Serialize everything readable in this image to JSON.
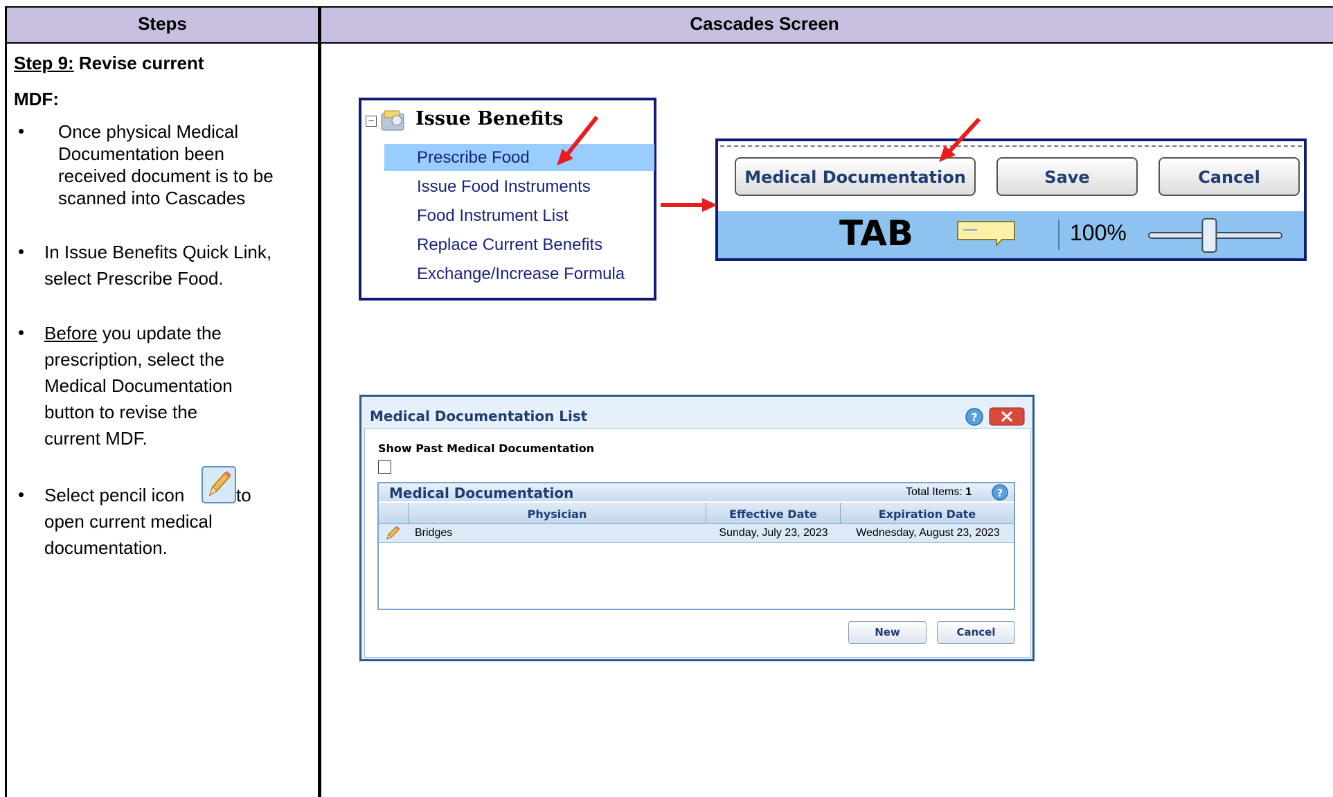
{
  "table": {
    "col_steps": "Steps",
    "col_screen": "Cascades Screen"
  },
  "steps": {
    "step_label": "Step 9:",
    "step_title": " Revise current",
    "mdf": "MDF:",
    "b1": [
      "Once physical Medical",
      "Documentation been",
      "received  document is to be",
      "scanned into Cascades"
    ],
    "b2": [
      "In Issue Benefits Quick Link,",
      "select Prescribe Food."
    ],
    "b3_underlined": "Before",
    "b3": [
      " you update the",
      "prescription, select the",
      "Medical Documentation",
      "button to revise the",
      "current MDF."
    ],
    "b4a": "Select pencil icon",
    "b4b": " to",
    "b4": [
      "open current medical",
      "documentation."
    ]
  },
  "issue_benefits": {
    "title": "Issue Benefits",
    "items": [
      "Prescribe Food",
      "Issue Food Instruments",
      "Food Instrument List",
      "Replace Current Benefits",
      "Exchange/Increase Formula"
    ]
  },
  "toolbar": {
    "medical_doc_label": "Medical Documentation",
    "save_label": "Save",
    "cancel_label": "Cancel",
    "tab_label": "TAB",
    "zoom": "100%",
    "zoom_level": 0.45
  },
  "dialog": {
    "title": "Medical Documentation List",
    "show_past": "Show Past Medical Documentation",
    "grid_title": "Medical Documentation",
    "total_label": "Total Items:",
    "total_value": "1",
    "columns": [
      "Physician",
      "Effective Date",
      "Expiration Date"
    ],
    "rows": [
      {
        "physician": "Bridges",
        "effective": "Sunday, July 23, 2023",
        "expiration": "Wednesday, August 23, 2023"
      }
    ],
    "new_label": "New",
    "cancel_label": "Cancel"
  },
  "colors": {
    "header_bg": "#c9bfe0",
    "panel_border": "#0f1a7a",
    "highlight": "#99ccff",
    "arrow": "#e61e1e"
  }
}
